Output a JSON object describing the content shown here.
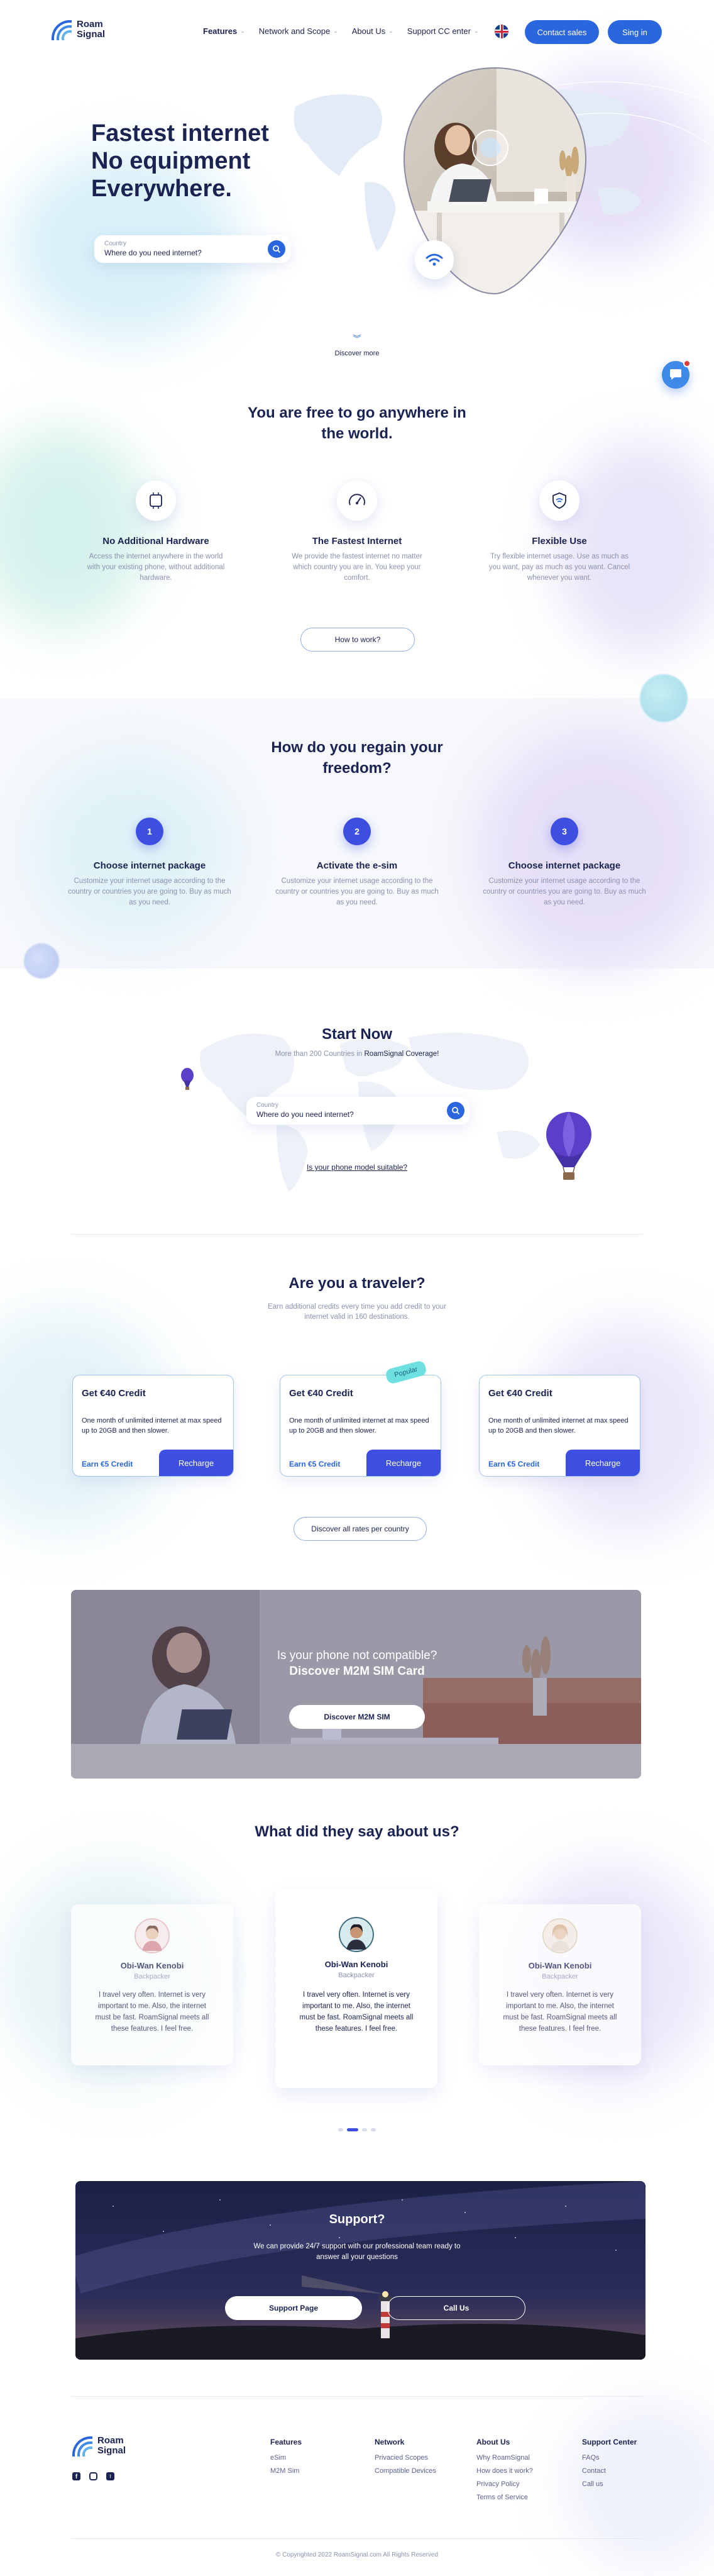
{
  "header": {
    "logo_line1": "Roam",
    "logo_line2": "Signal",
    "nav": [
      "Features",
      "Network and Scope",
      "About Us",
      "Support CC enter"
    ],
    "contact_label": "Contact sales",
    "signin_label": "Sing in"
  },
  "hero": {
    "title_line1": "Fastest internet",
    "title_line2": "No equipment",
    "title_line3": "Everywhere.",
    "search_label": "Country",
    "search_value": "Where do you need internet?",
    "discover": "Discover more"
  },
  "freedom": {
    "title_line1": "You are free to go anywhere in",
    "title_line2": "the world.",
    "features": [
      {
        "icon": "chip-icon",
        "title": "No Additional Hardware",
        "text": "Access the internet anywhere in the world with your existing phone, without additional hardware."
      },
      {
        "icon": "speedometer-icon",
        "title": "The Fastest Internet",
        "text": "We provide the fastest internet no matter which country you are in. You keep your comfort."
      },
      {
        "icon": "shield-icon",
        "title": "Flexible Use",
        "text": "Try flexible internet usage. Use as much as you want, pay as much as you want. Cancel whenever you want."
      }
    ],
    "how_button": "How to work?"
  },
  "regain": {
    "title_line1": "How do you regain your",
    "title_line2": "freedom?",
    "steps": [
      {
        "num": "1",
        "title": "Choose internet package",
        "text": "Customize your internet usage according to the country or countries you are going to. Buy as much as you need."
      },
      {
        "num": "2",
        "title": "Activate the e-sim",
        "text": "Customize your internet usage according to the country or countries you are going to. Buy as much as you need."
      },
      {
        "num": "3",
        "title": "Choose internet package",
        "text": "Customize your internet usage according to the country or countries you are going to. Buy as much as you need."
      }
    ]
  },
  "start": {
    "title": "Start Now",
    "subtitle_prefix": "More than 200 Countries in",
    "subtitle_brand": "RoamSignal Coverage!",
    "search_label": "Country",
    "search_value": "Where do you need internet?",
    "phone_link": "Is your phone model suitable?"
  },
  "traveler": {
    "title": "Are you a traveler?",
    "subtitle_line1": "Earn additional credits every time you add credit to your",
    "subtitle_line2": "internet valid in 160 destinations.",
    "popular_badge": "Popular",
    "cards": [
      {
        "title": "Get €40 Credit",
        "text": "One month of unlimited internet at max speed up to 20GB and then slower.",
        "earn": "Earn €5 Credit",
        "button": "Recharge"
      },
      {
        "title": "Get €40 Credit",
        "text": "One month of unlimited internet at max speed up to 20GB and then slower.",
        "earn": "Earn €5 Credit",
        "button": "Recharge"
      },
      {
        "title": "Get €40 Credit",
        "text": "One month of unlimited internet at max speed up to 20GB and then slower.",
        "earn": "Earn €5 Credit",
        "button": "Recharge"
      }
    ],
    "rates_button": "Discover all rates per country"
  },
  "m2m": {
    "line1": "Is your phone not compatible?",
    "line2": "Discover M2M SIM Card",
    "button": "Discover M2M SIM"
  },
  "testimonials": {
    "title": "What did they say about us?",
    "items": [
      {
        "name": "Obi-Wan Kenobi",
        "role": "Backpacker",
        "text": "I travel very often. Internet is very important to me. Also, the internet must be fast. RoamSignal meets all these features. I feel free."
      },
      {
        "name": "Obi-Wan Kenobi",
        "role": "Backpacker",
        "text": "I travel very often. Internet is very important to me. Also, the internet must be fast. RoamSignal meets all these features. I feel free."
      },
      {
        "name": "Obi-Wan Kenobi",
        "role": "Backpacker",
        "text": "I travel very often. Internet is very important to me. Also, the internet must be fast. RoamSignal meets all these features. I feel free."
      }
    ]
  },
  "support": {
    "title": "Support?",
    "text_line1": "We can provide 24/7 support with our professional team ready to",
    "text_line2": "answer all your questions",
    "page_button": "Support Page",
    "call_button": "Call Us"
  },
  "footer": {
    "columns": [
      {
        "title": "Features",
        "links": [
          "eSim",
          "M2M Sim"
        ]
      },
      {
        "title": "Network",
        "links": [
          "Privacied Scopes",
          "Compatible Devices"
        ]
      },
      {
        "title": "About Us",
        "links": [
          "Why RoamSignal",
          "How does it work?",
          "Privacy Policy",
          "Terms of Service"
        ]
      },
      {
        "title": "Support Center",
        "links": [
          "FAQs",
          "Contact",
          "Call us"
        ]
      }
    ],
    "copyright": "© Copyrighted 2022 RoamSignal.com All Rights Reserved"
  },
  "colors": {
    "primary": "#2a66dd",
    "accent": "#3d4fe0",
    "navy": "#1a2352",
    "muted": "#8a92b2"
  }
}
